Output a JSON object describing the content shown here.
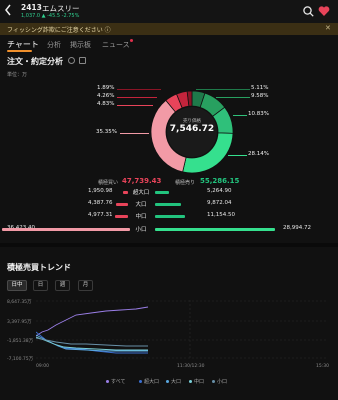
{
  "header": {
    "code": "2413",
    "name": "エムスリー",
    "quote": "1,037.0 ▲ -45.5 -2.75%"
  },
  "banner": {
    "text": "フィッシング詐欺にご注意ください ⓘ",
    "close": "✕"
  },
  "tabs": [
    {
      "label": "チャート"
    },
    {
      "label": "分析"
    },
    {
      "label": "掲示板"
    },
    {
      "label": "ニュース"
    }
  ],
  "analysis": {
    "title": "注文・約定分析",
    "unit": "単位：万",
    "center_label": "売り価格",
    "center_value": "7,546.72",
    "left_pcts": [
      "1.89%",
      "4.26%",
      "4.83%",
      "35.35%"
    ],
    "right_pcts": [
      "5.11%",
      "9.58%",
      "10.83%",
      "28.14%"
    ],
    "buy_label": "積極買い",
    "buy_value": "47,739.43",
    "sell_label": "積極売り",
    "sell_value": "55,286.15",
    "rows": [
      {
        "buy": "1,950.98",
        "cat": "超大口",
        "sell": "5,264.90",
        "buy_pct": 0.041,
        "sell_pct": 0.095
      },
      {
        "buy": "4,387.76",
        "cat": "大口",
        "sell": "9,872.04",
        "buy_pct": 0.092,
        "sell_pct": 0.179
      },
      {
        "buy": "4,977.31",
        "cat": "中口",
        "sell": "11,154.50",
        "buy_pct": 0.104,
        "sell_pct": 0.202
      },
      {
        "buy": "36,423.40",
        "cat": "小口",
        "sell": "28,994.72",
        "buy_pct": 1.0,
        "sell_pct": 0.524
      }
    ]
  },
  "trend": {
    "title": "積極売買トレンド",
    "periods": [
      "日中",
      "日",
      "週",
      "月"
    ],
    "yticks": [
      "8,647.35万",
      "3,397.95万",
      "-1,851.38万",
      "-7,100.75万"
    ],
    "xticks": [
      "09:00",
      "11:30/12:30",
      "15:30"
    ],
    "legend": [
      "すべて",
      "超大口",
      "大口",
      "中口",
      "小口"
    ]
  },
  "colors": {
    "buy": "#e8445a",
    "sell": "#22c47e",
    "accent": "#f0902c"
  },
  "chart_data": {
    "type": "pie",
    "title": "注文・約定分析",
    "center_label": "売り価格",
    "center_value": "7,546.72",
    "slices": [
      {
        "label": "超大口 売",
        "value": 5.11,
        "color": "#1f7a4a"
      },
      {
        "label": "大口 売",
        "value": 9.58,
        "color": "#28a060"
      },
      {
        "label": "中口 売",
        "value": 10.83,
        "color": "#2fc07a"
      },
      {
        "label": "小口 売",
        "value": 28.14,
        "color": "#35e08e"
      },
      {
        "label": "小口 買",
        "value": 35.35,
        "color": "#f29aa6"
      },
      {
        "label": "中口 買",
        "value": 4.83,
        "color": "#e8445a"
      },
      {
        "label": "大口 買",
        "value": 4.26,
        "color": "#c4243c"
      },
      {
        "label": "超大口 買",
        "value": 1.89,
        "color": "#8a1426"
      }
    ]
  }
}
